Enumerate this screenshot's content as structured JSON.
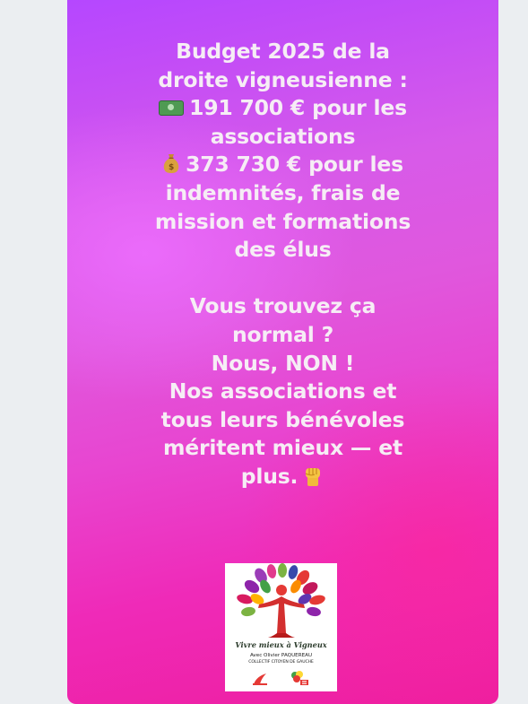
{
  "post": {
    "lines": {
      "l1": "Budget 2025 de la",
      "l2": "droite vigneusienne :",
      "l3": "191 700 € pour les",
      "l4": "associations",
      "l5": "373 730 € pour les",
      "l6": "indemnités, frais de",
      "l7": "mission et formations",
      "l8": "des élus",
      "l9": "Vous trouvez ça",
      "l10": "normal ?",
      "l11": "Nous, NON !",
      "l12": "Nos associations et",
      "l13": "tous leurs bénévoles",
      "l14": "méritent mieux — et",
      "l15": "plus."
    },
    "emojis": [
      "dollar-banknote-icon",
      "money-bag-icon",
      "raised-fist-icon"
    ]
  },
  "logo": {
    "slogan": "Vivre mieux à Vigneux",
    "author": "Avec Olivier PAQUEREAU",
    "collective": "COLLECTIF CITOYEN DE GAUCHE"
  },
  "colors": {
    "page_background": "#ebeef1",
    "gradient_top": "#b547ff",
    "gradient_bottom": "#ee1e9f",
    "text": "#f6edf5"
  }
}
